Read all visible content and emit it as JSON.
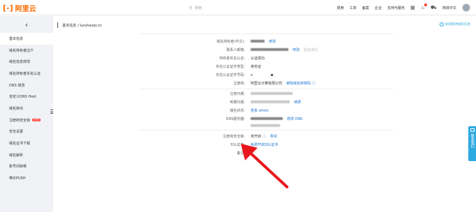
{
  "header": {
    "logo_mark": "[-]",
    "logo_text": "阿里云",
    "search_placeholder": "搜索",
    "nav": [
      "费用",
      "工单",
      "备案",
      "企业",
      "支持与服务"
    ],
    "language": "简体中文",
    "icons": [
      "terminal-icon",
      "bell-icon",
      "cart-icon"
    ]
  },
  "sidebar": {
    "back_symbol": "‹",
    "items": [
      {
        "label": "基本信息",
        "active": true
      },
      {
        "label": "域名持有者过户"
      },
      {
        "label": "域名信息修改"
      },
      {
        "label": "域名持有者实名认证"
      },
      {
        "label": "DNS 修改"
      },
      {
        "label": "自定义DNS Host"
      },
      {
        "label": "域名转出"
      },
      {
        "label": "注册商安全锁",
        "tag": "NEW"
      },
      {
        "label": "安全设置"
      },
      {
        "label": "域名证书下载"
      },
      {
        "label": "域名解析"
      },
      {
        "label": "账号间转移"
      },
      {
        "label": "带价PUSH"
      }
    ]
  },
  "content": {
    "breadcrumb": "基本信息 / luoshaoqi.cn",
    "help_link": "如何修改域名信息",
    "fields": {
      "holder_cn": {
        "label": "域名持有者(中文):",
        "link": "修改"
      },
      "contact_email": {
        "label": "联系人邮箱:",
        "link": "修改",
        "extra": "验证通过"
      },
      "realname_status": {
        "label": "持有者实名认证:",
        "value": "认证成功"
      },
      "cert_type": {
        "label": "实名认证证件类型:",
        "value": "身份证"
      },
      "cert_no": {
        "label": "实名认证证件号码:"
      },
      "registrar": {
        "label": "注册商:",
        "value": "阿里云计算有限公司",
        "link": "索取域名转移码"
      },
      "reg_date": {
        "label": "注册日期:"
      },
      "expire_date": {
        "label": "到期日期:",
        "link": "续费"
      },
      "domain_status": {
        "label": "域名状态:",
        "link": "查看 whois"
      },
      "dns_server": {
        "label": "DNS服务器:",
        "link": "修改 DNS"
      },
      "security_lock": {
        "label": "注册商安全锁:",
        "value": "未开启",
        "link": "购买"
      },
      "ssl": {
        "label": "SSL证书:",
        "link": "免费开启SSL证书"
      },
      "remark": {
        "label": "备注:"
      }
    }
  },
  "float_tab": {
    "label": "联系我们"
  },
  "colors": {
    "brand": "#ff6a00",
    "link": "#1c74d4",
    "accent": "#2ea9df",
    "arrow": "#e8161b"
  }
}
